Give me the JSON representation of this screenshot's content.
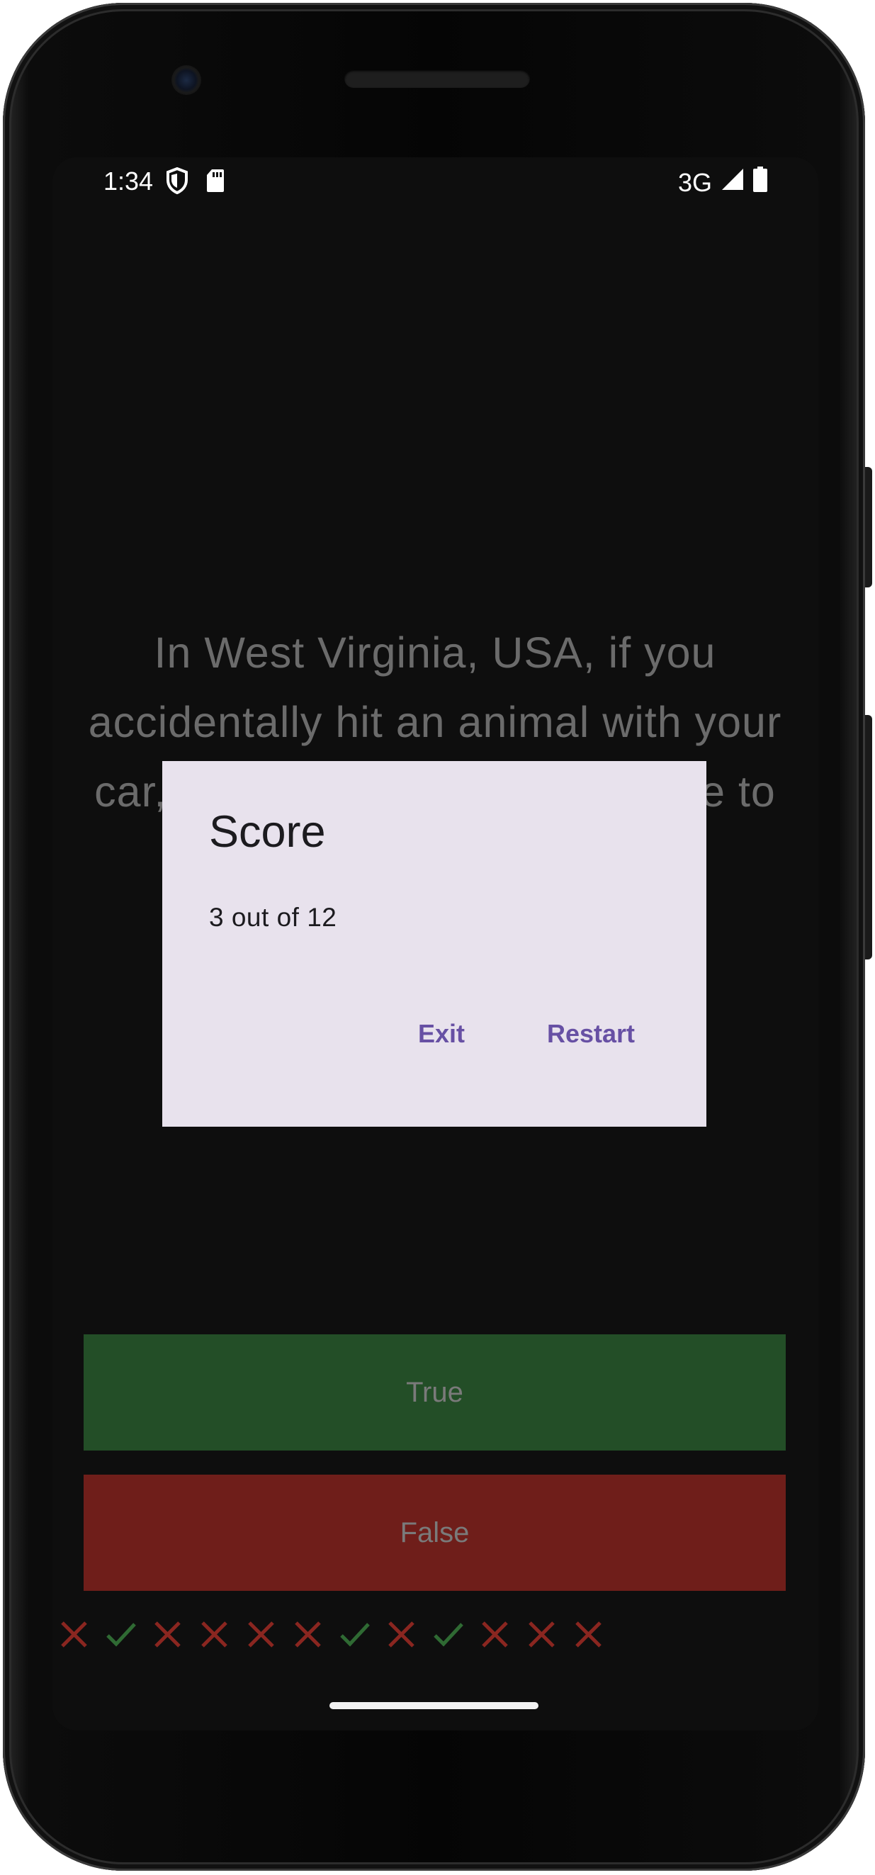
{
  "status_bar": {
    "time": "1:34",
    "network": "3G",
    "icons": [
      "shield-icon",
      "sd-card-icon",
      "signal-icon",
      "battery-icon"
    ]
  },
  "quiz": {
    "question": "In West Virginia, USA, if you accidentally hit an animal with your car, you are free to take it home to eat.",
    "true_label": "True",
    "false_label": "False",
    "score_marks": [
      "wrong",
      "right",
      "wrong",
      "wrong",
      "wrong",
      "wrong",
      "right",
      "wrong",
      "right",
      "wrong",
      "wrong",
      "wrong"
    ]
  },
  "dialog": {
    "title": "Score",
    "body": "3 out of 12",
    "exit_label": "Exit",
    "restart_label": "Restart"
  },
  "colors": {
    "background": "#0e0e0e",
    "true_button": "#234e27",
    "false_button": "#6f1e1a",
    "dialog_surface": "#e8e2ed",
    "dialog_action": "#6750a4",
    "mark_right": "#2f6a33",
    "mark_wrong": "#8a2620"
  }
}
